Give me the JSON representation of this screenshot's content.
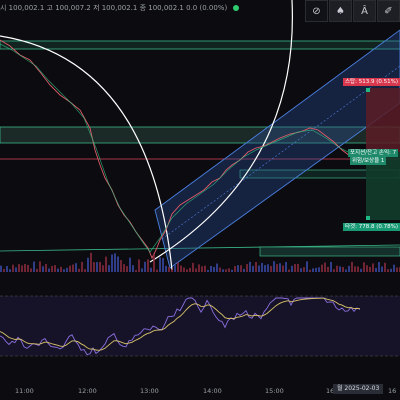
{
  "ohlc": {
    "open": "시 100,002.1",
    "high": "고 100,007.2",
    "low": "저 100,002.1",
    "close": "종 100,002.1",
    "change": "0.0 (0.00%)"
  },
  "toolbar": {
    "b1": "⊘",
    "b2": "♠",
    "b3": "Â",
    "b4": "✐"
  },
  "tags": {
    "stop": "스탑: 513.9 (0.51%) 5",
    "entry": "포지션/잔고 손익: 7",
    "pnl": "위험/보상율 1",
    "target": "타겟: 778.8 (0.78%) 7"
  },
  "time_axis": {
    "t1": "11:00",
    "t2": "12:00",
    "t3": "13:00",
    "t4": "14:00",
    "t5": "15:00",
    "t6": "16:",
    "date": "월 2025-02-03",
    "t7": "16"
  },
  "colors": {
    "accent": "#3c7bd8",
    "stop": "#e04a5f",
    "target": "#1fb985",
    "zone": "#53d2a6"
  }
}
